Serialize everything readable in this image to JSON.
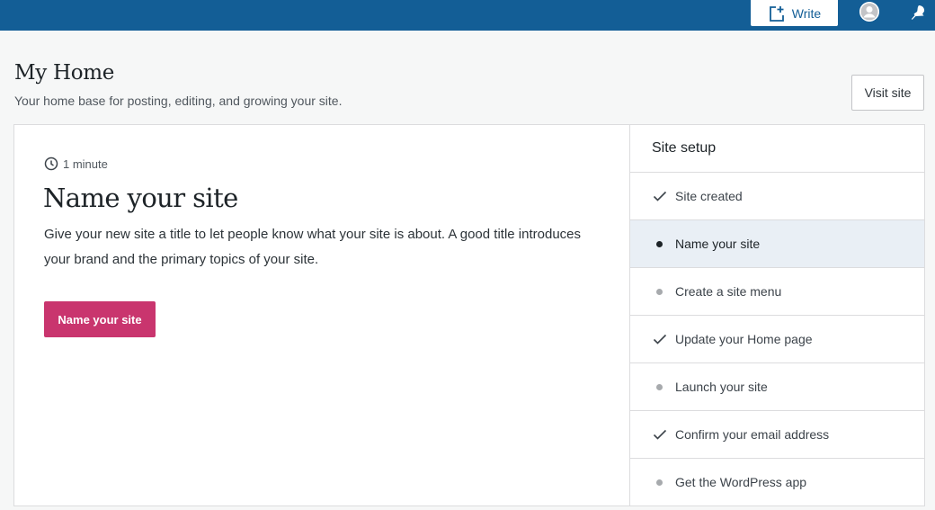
{
  "masterbar": {
    "write_label": "Write",
    "write_icon": "write-post-icon",
    "avatar_icon": "avatar-icon",
    "notifications_icon": "bell-icon",
    "background": "#135e96"
  },
  "header": {
    "title": "My Home",
    "subtitle": "Your home base for posting, editing, and growing your site.",
    "visit_site_label": "Visit site"
  },
  "task": {
    "time": "1 minute",
    "time_icon": "clock-icon",
    "title": "Name your site",
    "description": "Give your new site a title to let people know what your site is about. A good title introduces your brand and the primary topics of your site.",
    "button_label": "Name your site",
    "button_color": "#c9356e"
  },
  "site_setup": {
    "title": "Site setup",
    "steps": [
      {
        "label": "Site created",
        "status": "done"
      },
      {
        "label": "Name your site",
        "status": "active"
      },
      {
        "label": "Create a site menu",
        "status": "pending"
      },
      {
        "label": "Update your Home page",
        "status": "done"
      },
      {
        "label": "Launch your site",
        "status": "pending"
      },
      {
        "label": "Confirm your email address",
        "status": "done"
      },
      {
        "label": "Get the WordPress app",
        "status": "pending"
      }
    ]
  }
}
